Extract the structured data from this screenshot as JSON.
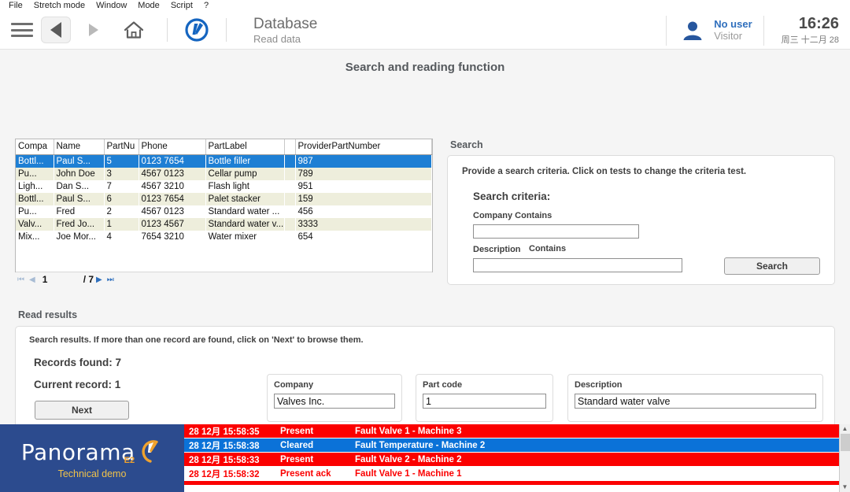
{
  "menubar": {
    "items": [
      "File",
      "Stretch mode",
      "Window",
      "Mode",
      "Script",
      "?"
    ]
  },
  "toolbar": {
    "app_title": "Database",
    "app_subtitle": "Read data",
    "user_name": "No user",
    "user_role": "Visitor",
    "clock_time": "16:26",
    "clock_date": "周三 十二月 28"
  },
  "page": {
    "title": "Search and reading function"
  },
  "grid": {
    "columns": [
      "Compa",
      "Name",
      "PartNu",
      "Phone",
      "PartLabel",
      "",
      "ProviderPartNumber"
    ],
    "rows": [
      {
        "company": "Bottl...",
        "name": "Paul S...",
        "partnum": "5",
        "phone": "0123 7654",
        "partlabel": "Bottle filler",
        "provider": "987",
        "style": "sel"
      },
      {
        "company": "Pu...",
        "name": "John Doe",
        "partnum": "3",
        "phone": "4567 0123",
        "partlabel": "Cellar pump",
        "provider": "789",
        "style": "even"
      },
      {
        "company": "Ligh...",
        "name": "Dan S...",
        "partnum": "7",
        "phone": "4567 3210",
        "partlabel": "Flash light",
        "provider": "951",
        "style": "odd"
      },
      {
        "company": "Bottl...",
        "name": "Paul S...",
        "partnum": "6",
        "phone": "0123 7654",
        "partlabel": "Palet stacker",
        "provider": "159",
        "style": "even"
      },
      {
        "company": "Pu...",
        "name": "Fred",
        "partnum": "2",
        "phone": "4567 0123",
        "partlabel": "Standard water ...",
        "provider": "456",
        "style": "odd"
      },
      {
        "company": "Valv...",
        "name": "Fred Jo...",
        "partnum": "1",
        "phone": "0123 4567",
        "partlabel": "Standard water v...",
        "provider": "3333",
        "style": "even"
      },
      {
        "company": "Mix...",
        "name": "Joe Mor...",
        "partnum": "4",
        "phone": "7654 3210",
        "partlabel": "Water mixer",
        "provider": "654",
        "style": "odd"
      }
    ],
    "pager": {
      "current_page": "1",
      "total": "/ 7"
    }
  },
  "search": {
    "section_label": "Search",
    "hint": "Provide a search criteria. Click on tests to change the criteria test.",
    "criteria_title": "Search criteria:",
    "company_label": "Company Contains",
    "company_value": "",
    "description_label": "Description",
    "description_operator": "Contains",
    "description_value": "",
    "search_button": "Search"
  },
  "results": {
    "section_label": "Read results",
    "hint": "Search results. If more than one record are found, click on 'Next' to browse them.",
    "records_found": "Records found: 7",
    "current_record": "Current record: 1",
    "next_button": "Next",
    "fields": [
      {
        "label": "Company",
        "value": "Valves Inc."
      },
      {
        "label": "Part code",
        "value": "1"
      },
      {
        "label": "Description",
        "value": "Standard water valve"
      }
    ]
  },
  "brand": {
    "wordmark": "Panorama",
    "edition": "E2",
    "tagline": "Technical demo"
  },
  "alarms": {
    "rows": [
      {
        "time": "28 12月 15:58:35",
        "state": "Present",
        "message": "Fault Valve 1 - Machine 3",
        "style": "red"
      },
      {
        "time": "28 12月 15:58:38",
        "state": "Cleared",
        "message": "Fault Temperature - Machine 2",
        "style": "blue"
      },
      {
        "time": "28 12月 15:58:33",
        "state": "Present",
        "message": "Fault Valve 2 - Machine 2",
        "style": "red"
      },
      {
        "time": "28 12月 15:58:32",
        "state": "Present ack",
        "message": "Fault Valve 1 - Machine 1",
        "style": "white"
      }
    ]
  },
  "colors": {
    "accent_blue": "#2f6fbd",
    "brand_navy": "#2c4b8e",
    "alarm_red": "#fb0000",
    "alarm_blue": "#0b72d8",
    "selection_blue": "#1e7fd4"
  }
}
